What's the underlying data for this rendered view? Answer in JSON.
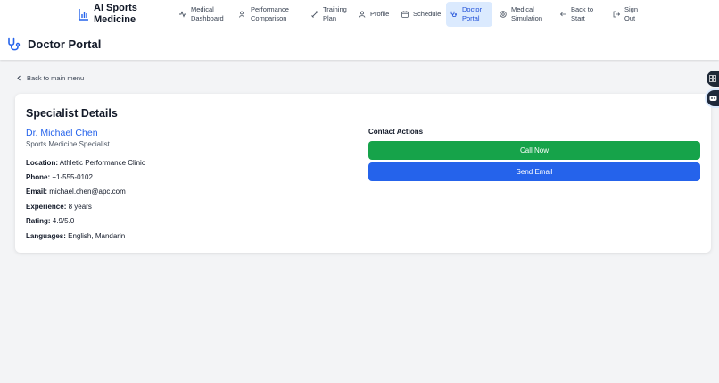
{
  "brand": {
    "name": "AI Sports Medicine",
    "icon": "bar-chart-icon",
    "accent": "#2563eb"
  },
  "nav": {
    "items": [
      {
        "id": "medical-dashboard",
        "label": "Medical Dashboard",
        "icon": "activity-icon"
      },
      {
        "id": "performance-comparison",
        "label": "Performance Comparison",
        "icon": "users-icon"
      },
      {
        "id": "training-plan",
        "label": "Training Plan",
        "icon": "dumbbell-icon"
      },
      {
        "id": "profile",
        "label": "Profile",
        "icon": "user-icon"
      },
      {
        "id": "schedule",
        "label": "Schedule",
        "icon": "calendar-icon"
      },
      {
        "id": "doctor-portal",
        "label": "Doctor Portal",
        "icon": "stethoscope-icon",
        "active": true
      },
      {
        "id": "medical-simulation",
        "label": "Medical Simulation",
        "icon": "target-icon"
      },
      {
        "id": "back-to-start",
        "label": "Back to Start",
        "icon": "arrow-left-icon"
      },
      {
        "id": "sign-out",
        "label": "Sign Out",
        "icon": "logout-icon"
      }
    ]
  },
  "page": {
    "title": "Doctor Portal",
    "icon": "stethoscope-icon"
  },
  "back_link": {
    "label": "Back to main menu",
    "icon": "chevron-left-icon"
  },
  "specialist": {
    "section_title": "Specialist Details",
    "name": "Dr. Michael Chen",
    "specialty": "Sports Medicine Specialist",
    "details": [
      {
        "label": "Location:",
        "value": "Athletic Performance Clinic"
      },
      {
        "label": "Phone:",
        "value": "+1-555-0102"
      },
      {
        "label": "Email:",
        "value": "michael.chen@apc.com"
      },
      {
        "label": "Experience:",
        "value": "8 years"
      },
      {
        "label": "Rating:",
        "value": "4.9/5.0"
      },
      {
        "label": "Languages:",
        "value": "English, Mandarin"
      }
    ]
  },
  "contact": {
    "title": "Contact Actions",
    "call_label": "Call Now",
    "email_label": "Send Email",
    "call_color": "#16a34a",
    "email_color": "#2563eb"
  },
  "widgets": [
    {
      "icon": "grid-icon"
    },
    {
      "icon": "chat-bot-icon"
    }
  ]
}
